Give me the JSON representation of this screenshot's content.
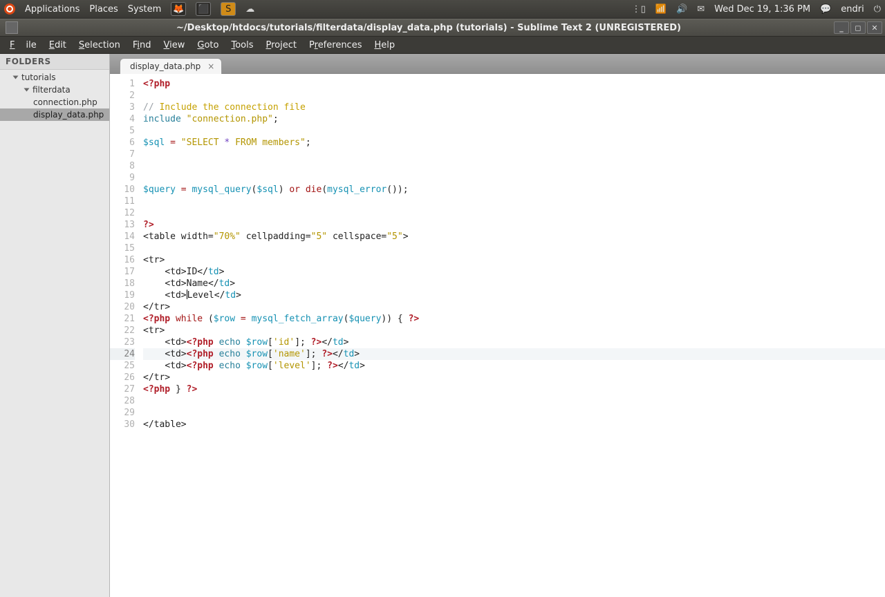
{
  "panel": {
    "menus": [
      "Applications",
      "Places",
      "System"
    ],
    "clock": "Wed Dec 19,  1:36 PM",
    "user": "endri"
  },
  "window": {
    "title": "~/Desktop/htdocs/tutorials/filterdata/display_data.php (tutorials) - Sublime Text 2 (UNREGISTERED)"
  },
  "menubar": [
    "File",
    "Edit",
    "Selection",
    "Find",
    "View",
    "Goto",
    "Tools",
    "Project",
    "Preferences",
    "Help"
  ],
  "sidebar": {
    "header": "FOLDERS",
    "root": "tutorials",
    "folder1": "filterdata",
    "files": [
      "connection.php",
      "display_data.php"
    ],
    "selected": "display_data.php"
  },
  "tabs": [
    {
      "label": "display_data.php"
    }
  ],
  "current_line": 24,
  "code_lines": [
    {
      "n": 1,
      "h": "<span class='t-tag'>&lt;?php</span>"
    },
    {
      "n": 2,
      "h": ""
    },
    {
      "n": 3,
      "h": "<span class='t-cmt'>// </span><span class='t-cmt2'>Include the connection file</span>"
    },
    {
      "n": 4,
      "h": "<span class='t-key'>include</span> <span class='t-str'>\"connection.php\"</span><span class='t-punc'>;</span>"
    },
    {
      "n": 5,
      "h": ""
    },
    {
      "n": 6,
      "h": "<span class='t-var'>$sql</span> <span class='t-kw2'>=</span> <span class='t-str'>\"SELECT </span><span class='t-const'>*</span><span class='t-str'> FROM members\"</span><span class='t-punc'>;</span>"
    },
    {
      "n": 7,
      "h": ""
    },
    {
      "n": 8,
      "h": ""
    },
    {
      "n": 9,
      "h": ""
    },
    {
      "n": 10,
      "h": "<span class='t-var'>$query</span> <span class='t-kw2'>=</span> <span class='t-func'>mysql_query</span><span class='t-punc'>(</span><span class='t-var'>$sql</span><span class='t-punc'>)</span> <span class='t-kw2'>or</span> <span class='t-kw2'>die</span><span class='t-punc'>(</span><span class='t-func'>mysql_error</span><span class='t-punc'>());</span>"
    },
    {
      "n": 11,
      "h": ""
    },
    {
      "n": 12,
      "h": ""
    },
    {
      "n": 13,
      "h": "<span class='t-tag'>?&gt;</span>"
    },
    {
      "n": 14,
      "h": "<span class='t-punc'>&lt;table width=</span><span class='t-str'>\"70%\"</span><span class='t-punc'> cellpadding=</span><span class='t-str'>\"5\"</span><span class='t-punc'> cellspace=</span><span class='t-str'>\"5\"</span><span class='t-punc'>&gt;</span>"
    },
    {
      "n": 15,
      "h": ""
    },
    {
      "n": 16,
      "h": "<span class='t-punc'>&lt;tr&gt;</span>"
    },
    {
      "n": 17,
      "h": "    <span class='t-punc'>&lt;td&gt;</span>ID<span class='t-punc'>&lt;/</span><span class='t-var'>td</span><span class='t-punc'>&gt;</span>"
    },
    {
      "n": 18,
      "h": "    <span class='t-punc'>&lt;td&gt;</span>Name<span class='t-punc'>&lt;/</span><span class='t-var'>td</span><span class='t-punc'>&gt;</span>"
    },
    {
      "n": 19,
      "h": "    <span class='t-punc'>&lt;td&gt;</span><span class='caret'></span>Level<span class='t-punc'>&lt;/</span><span class='t-var'>td</span><span class='t-punc'>&gt;</span>"
    },
    {
      "n": 20,
      "h": "<span class='t-punc'>&lt;/tr&gt;</span>"
    },
    {
      "n": 21,
      "h": "<span class='t-tag'>&lt;?php</span> <span class='t-kw2'>while</span> <span class='t-punc'>(</span><span class='t-var'>$row</span> <span class='t-kw2'>=</span> <span class='t-func'>mysql_fetch_array</span><span class='t-punc'>(</span><span class='t-var'>$query</span><span class='t-punc'>)) {</span> <span class='t-tag'>?&gt;</span>"
    },
    {
      "n": 22,
      "h": "<span class='t-punc'>&lt;tr&gt;</span>"
    },
    {
      "n": 23,
      "h": "    <span class='t-punc'>&lt;td&gt;</span><span class='t-tag'>&lt;?php</span> <span class='t-key'>echo</span> <span class='t-var'>$row</span><span class='t-punc'>[</span><span class='t-str'>'id'</span><span class='t-punc'>];</span> <span class='t-tag'>?&gt;</span><span class='t-punc'>&lt;/</span><span class='t-var'>td</span><span class='t-punc'>&gt;</span>"
    },
    {
      "n": 24,
      "h": "    <span class='t-punc'>&lt;td&gt;</span><span class='t-tag'>&lt;?php</span> <span class='t-key'>echo</span> <span class='t-var'>$row</span><span class='t-punc'>[</span><span class='t-str'>'name'</span><span class='t-punc'>];</span> <span class='t-tag'>?&gt;</span><span class='t-punc'>&lt;/</span><span class='t-var'>td</span><span class='t-punc'>&gt;</span>"
    },
    {
      "n": 25,
      "h": "    <span class='t-punc'>&lt;td&gt;</span><span class='t-tag'>&lt;?php</span> <span class='t-key'>echo</span> <span class='t-var'>$row</span><span class='t-punc'>[</span><span class='t-str'>'level'</span><span class='t-punc'>];</span> <span class='t-tag'>?&gt;</span><span class='t-punc'>&lt;/</span><span class='t-var'>td</span><span class='t-punc'>&gt;</span>"
    },
    {
      "n": 26,
      "h": "<span class='t-punc'>&lt;/tr&gt;</span>"
    },
    {
      "n": 27,
      "h": "<span class='t-tag'>&lt;?php</span> <span class='t-punc'>}</span> <span class='t-tag'>?&gt;</span>"
    },
    {
      "n": 28,
      "h": ""
    },
    {
      "n": 29,
      "h": ""
    },
    {
      "n": 30,
      "h": "<span class='t-punc'>&lt;/table&gt;</span>"
    }
  ]
}
